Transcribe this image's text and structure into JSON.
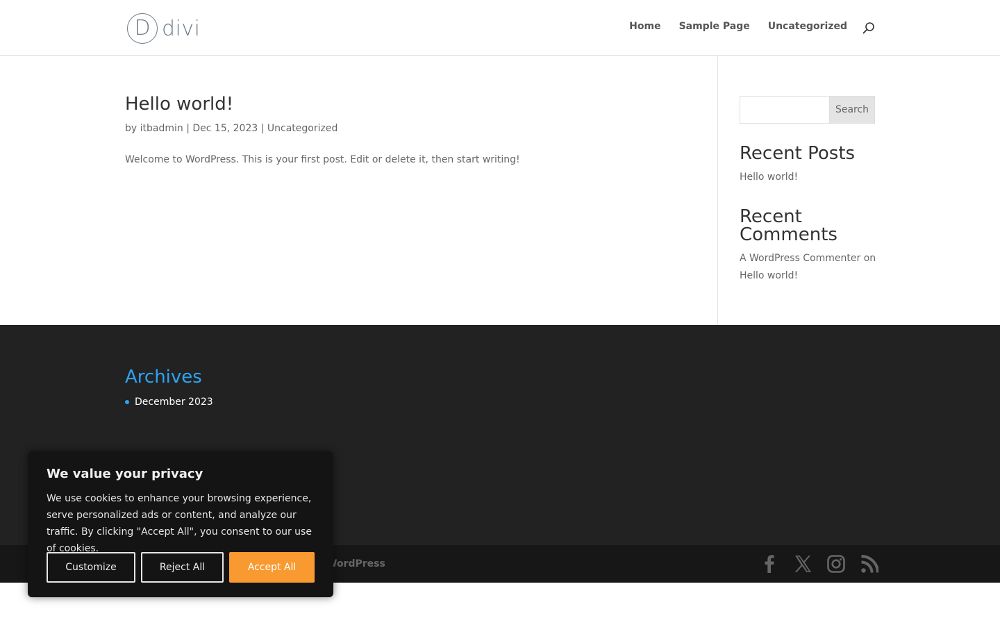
{
  "header": {
    "logo_text": "divi",
    "logo_letter": "D",
    "nav": [
      "Home",
      "Sample Page",
      "Uncategorized"
    ]
  },
  "post": {
    "title": "Hello world!",
    "meta_prefix": "by",
    "author": "itbadmin",
    "date": "Dec 15, 2023",
    "category": "Uncategorized",
    "separator": "|",
    "excerpt": "Welcome to WordPress. This is your first post. Edit or delete it, then start writing!"
  },
  "sidebar": {
    "search_button": "Search",
    "search_placeholder": "",
    "recent_posts_title": "Recent Posts",
    "recent_posts": [
      "Hello world!"
    ],
    "recent_comments_title_line1": "Recent",
    "recent_comments_title_line2": "Comments",
    "comment_author": "A WordPress Commenter",
    "comment_on": "on",
    "comment_post": "Hello world!"
  },
  "footer": {
    "archives_title": "Archives",
    "archives": [
      "December 2023"
    ],
    "credit_visible": "WordPress",
    "socials": [
      "facebook-icon",
      "x-icon",
      "instagram-icon",
      "rss-icon"
    ]
  },
  "cookie": {
    "title": "We value your privacy",
    "text": "We use cookies to enhance your browsing experience, serve personalized ads or content, and analyze our traffic. By clicking \"Accept All\", you consent to our use of cookies.",
    "customize": "Customize",
    "reject": "Reject All",
    "accept": "Accept All"
  },
  "colors": {
    "accent": "#2ea3f2",
    "accept_button": "#f89a30",
    "footer_bg": "#222222",
    "bottom_bar_bg": "#171717"
  }
}
